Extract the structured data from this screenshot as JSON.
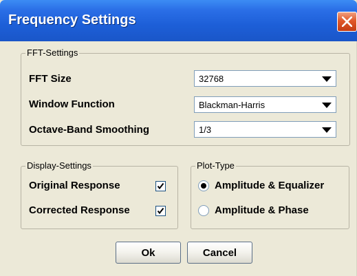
{
  "window": {
    "title": "Frequency Settings"
  },
  "fft_settings": {
    "legend": "FFT-Settings",
    "fft_size": {
      "label": "FFT Size",
      "value": "32768"
    },
    "window_function": {
      "label": "Window Function",
      "value": "Blackman-Harris"
    },
    "octave_smoothing": {
      "label": "Octave-Band Smoothing",
      "value": "1/3"
    }
  },
  "display_settings": {
    "legend": "Display-Settings",
    "original_response": {
      "label": "Original Response",
      "checked": true
    },
    "corrected_response": {
      "label": "Corrected Response",
      "checked": true
    }
  },
  "plot_type": {
    "legend": "Plot-Type",
    "options": [
      {
        "label": "Amplitude & Equalizer",
        "selected": true
      },
      {
        "label": "Amplitude & Phase",
        "selected": false
      }
    ]
  },
  "buttons": {
    "ok": "Ok",
    "cancel": "Cancel"
  },
  "colors": {
    "titlebar": "#1d5fd8",
    "window_bg": "#ece9d8",
    "close_button": "#e0582a"
  }
}
